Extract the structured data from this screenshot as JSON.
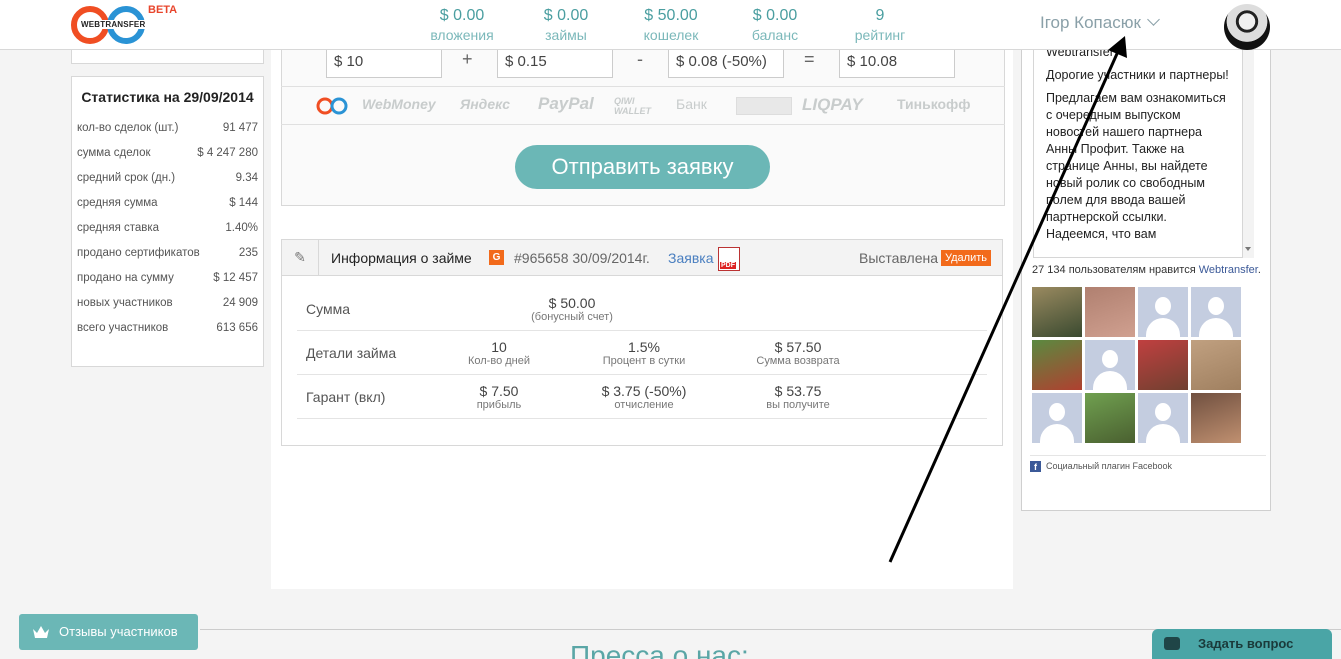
{
  "logo": {
    "text": "WEBTRANSFER",
    "beta": "BETA"
  },
  "header_stats": [
    {
      "value": "$ 0.00",
      "label": "вложения"
    },
    {
      "value": "$ 0.00",
      "label": "займы"
    },
    {
      "value": "$ 50.00",
      "label": "кошелек"
    },
    {
      "value": "$ 0.00",
      "label": "баланс"
    },
    {
      "value": "9",
      "label": "рейтинг"
    }
  ],
  "user": {
    "name": "Ігор Копасюк"
  },
  "stats": {
    "title": "Статистика на 29/09/2014",
    "rows": [
      {
        "label": "кол-во сделок (шт.)",
        "value": "91 477"
      },
      {
        "label": "сумма сделок",
        "value": "$ 4 247 280"
      },
      {
        "label": "средний срок (дн.)",
        "value": "9.34"
      },
      {
        "label": "средняя сумма",
        "value": "$ 144"
      },
      {
        "label": "средняя ставка",
        "value": "1.40%"
      },
      {
        "label": "продано сертификатов",
        "value": "235"
      },
      {
        "label": "продано на сумму",
        "value": "$ 12 457"
      },
      {
        "label": "новых участников",
        "value": "24 909"
      },
      {
        "label": "всего участников",
        "value": "613 656"
      }
    ]
  },
  "calc": {
    "amount": "$ 10",
    "plus": "+",
    "fee": "$ 0.15",
    "minus": "-",
    "discount": "$ 0.08 (-50%)",
    "equals": "=",
    "total": "$ 10.08"
  },
  "payments": [
    "WebMoney",
    "Яндекс",
    "PayPal",
    "QIWI WALLET",
    "Банк",
    "LIQPAY",
    "Тинькофф"
  ],
  "submit_label": "Отправить заявку",
  "loan": {
    "title": "Информация о займе",
    "badge": "G",
    "number": "#965658 30/09/2014г.",
    "request_link": "Заявка",
    "status": "Выставлена",
    "delete_label": "Удалить",
    "rows": [
      {
        "label": "Сумма",
        "cells": [
          {
            "value": "$ 50.00",
            "sub": "(бонусный счет)"
          }
        ]
      },
      {
        "label": "Детали займа",
        "cells": [
          {
            "value": "10",
            "sub": "Кол-во дней"
          },
          {
            "value": "1.5%",
            "sub": "Процент в сутки"
          },
          {
            "value": "$ 57.50",
            "sub": "Сумма возврата"
          }
        ]
      },
      {
        "label": "Гарант (вкл)",
        "cells": [
          {
            "value": "$ 7.50",
            "sub": "прибыль"
          },
          {
            "value": "$ 3.75 (-50%)",
            "sub": "отчисление"
          },
          {
            "value": "$ 53.75",
            "sub": "вы получите"
          }
        ]
      }
    ]
  },
  "facebook": {
    "post_partial": "Webtransfer",
    "p1": "Дорогие участники и партнеры!",
    "p2": "Предлагаем вам ознакомиться с очередным выпуском новостей нашего партнера Анны Профит. Также на странице Анны, вы найдете новый ролик со свободным полем для ввода вашей партнерской ссылки. Надеемся, что вам",
    "likes_prefix": "27 134 пользователям нравится",
    "likes_link": "Webtransfer",
    "likes_suffix": ".",
    "footer": "Социальный плагин Facebook"
  },
  "bottom": {
    "press_title": "Пресса о нас:",
    "reviews_label": "Отзывы участников",
    "ask_label": "Задать вопрос"
  },
  "colors": {
    "accent": "#6bb7b6",
    "header_text": "#4a9ea0",
    "orange": "#f26a1b",
    "fb_blue": "#3b5998"
  }
}
